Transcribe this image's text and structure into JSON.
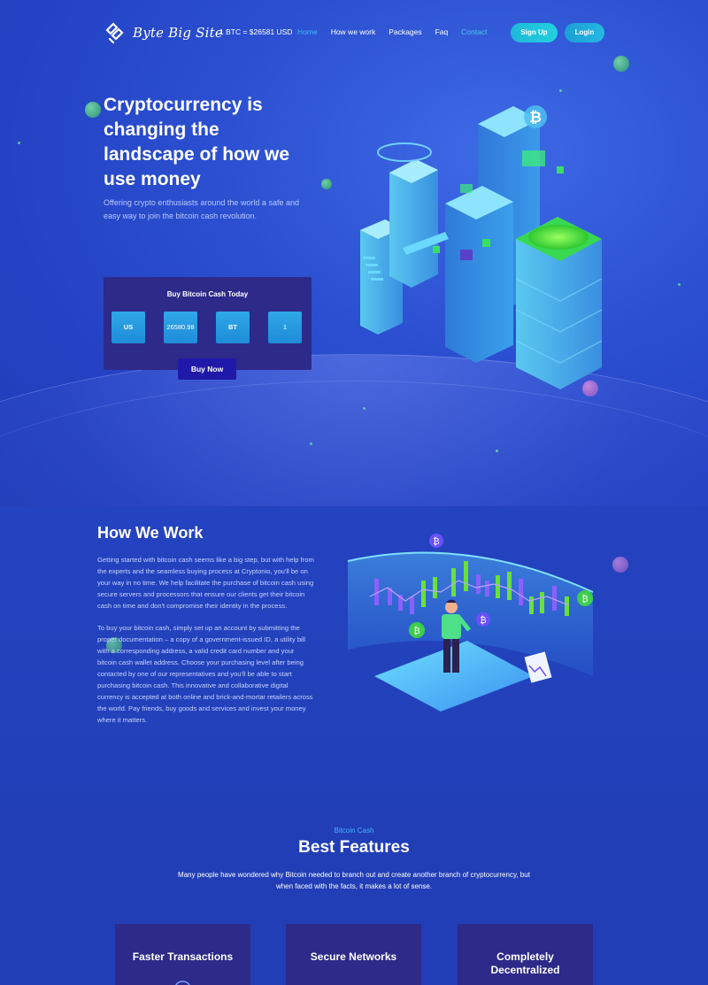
{
  "brand": {
    "name": "Byte Big Site"
  },
  "ticker": {
    "price": "1 BTC = $26581 USD"
  },
  "nav": {
    "items": [
      {
        "label": "Home",
        "state": "active"
      },
      {
        "label": "How we work",
        "state": "normal"
      },
      {
        "label": "Packages",
        "state": "normal"
      },
      {
        "label": "Faq",
        "state": "normal"
      },
      {
        "label": "Contact",
        "state": "muted"
      }
    ],
    "signup_label": "Sign Up",
    "login_label": "Login"
  },
  "hero": {
    "title": "Cryptocurrency is changing the landscape of how we use money",
    "subtitle": "Offering crypto enthusiasts around the world a safe and easy way to join the bitcoin cash revolution."
  },
  "buy_widget": {
    "title": "Buy Bitcoin Cash Today",
    "currency": "US",
    "amount": "26580.98",
    "coin": "BT",
    "quantity": "1",
    "button_label": "Buy Now"
  },
  "how_we_work": {
    "title": "How We Work",
    "paragraph_1": "Getting started with bitcoin cash seems like a big step, but with help from the experts and the seamless buying process at Cryptonio, you'll be on your way in no time. We help facilitate the purchase of bitcoin cash using secure servers and processors that ensure our clients get their bitcoin cash on time and don't compromise their identity in the process.",
    "paragraph_2": "To buy your bitcoin cash, simply set up an account by submitting the proper documentation – a copy of a government-issued ID, a utility bill with a corresponding address, a valid credit card number and your bitcoin cash wallet address. Choose your purchasing level after being contacted by one of our representatives and you'll be able to start purchasing bitcoin cash. This innovative and collaborative digital currency is accepted at both online and brick-and-mortar retailers across the world. Pay friends, buy goods and services and invest your money where it matters."
  },
  "features": {
    "kicker": "Bitcoin Cash",
    "title": "Best Features",
    "subtitle": "Many people have wondered why Bitcoin needed to branch out and create another branch of cryptocurrency, but when faced with the facts, it makes a lot of sense.",
    "cards": [
      {
        "title": "Faster Transactions"
      },
      {
        "title": "Secure Networks"
      },
      {
        "title": "Completely Decentralized"
      }
    ]
  },
  "colors": {
    "accent": "#3fb8ff",
    "background": "#2443c4",
    "card": "#2d2a8a",
    "button_cyan": "#22d0e0",
    "green": "#63e0a0"
  },
  "icons": [
    "logo-icon",
    "bitcoin-icon",
    "transaction-icon",
    "network-icon"
  ]
}
